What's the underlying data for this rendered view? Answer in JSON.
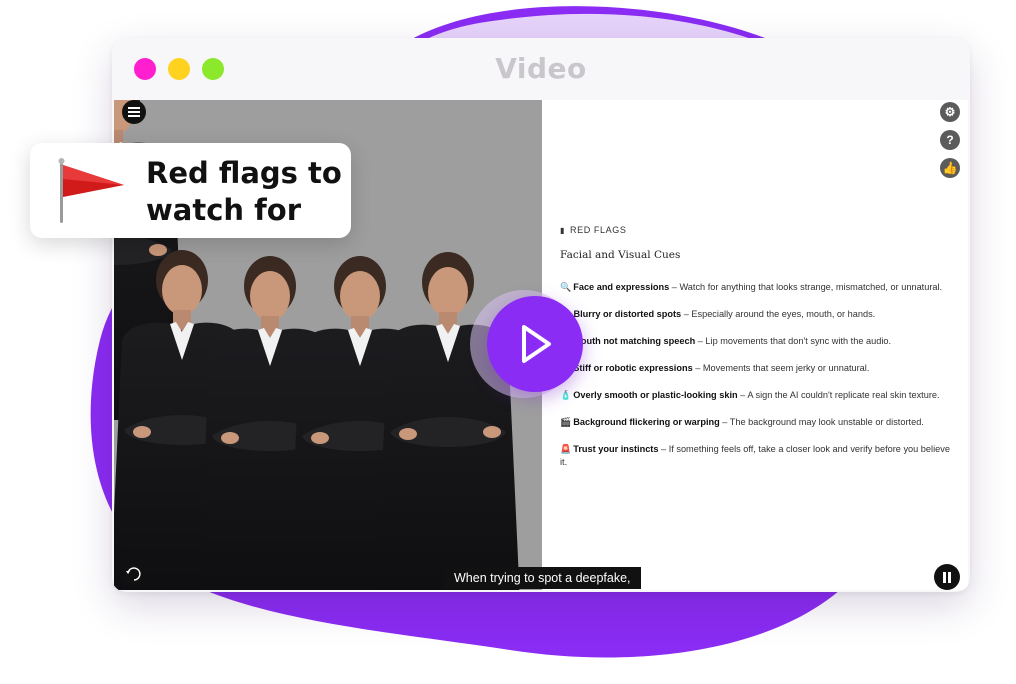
{
  "window": {
    "title": "Video"
  },
  "callout": {
    "text": "Red flags to watch for",
    "icon": "red-flag-icon"
  },
  "panel": {
    "header": "RED FLAGS",
    "subtitle": "Facial and Visual Cues",
    "items": [
      {
        "emoji": "🔍",
        "title": "Face and expressions",
        "desc": " – Watch for anything that looks strange, mismatched, or unnatural."
      },
      {
        "emoji": "👁",
        "title": "Blurry or distorted spots",
        "desc": " – Especially around the eyes, mouth, or hands."
      },
      {
        "emoji": "👄",
        "title": "Mouth not matching speech",
        "desc": " – Lip movements that don't sync with the audio."
      },
      {
        "emoji": "🤖",
        "title": "Stiff or robotic expressions",
        "desc": " – Movements that seem jerky or unnatural."
      },
      {
        "emoji": "🧴",
        "title": "Overly smooth or plastic-looking skin",
        "desc": " – A sign the AI couldn't replicate real skin texture."
      },
      {
        "emoji": "🎬",
        "title": "Background flickering or warping",
        "desc": " – The background may look unstable or distorted."
      },
      {
        "emoji": "🚨",
        "title": "Trust your instincts",
        "desc": " – If something feels off, take a closer look and verify before you believe it."
      }
    ]
  },
  "player": {
    "caption": "When trying to spot a deepfake,",
    "replay_label": "10"
  },
  "colors": {
    "accent": "#8a2cf3",
    "dot_close": "#ff1fce",
    "dot_min": "#ffd21f",
    "dot_max": "#8be82a"
  }
}
